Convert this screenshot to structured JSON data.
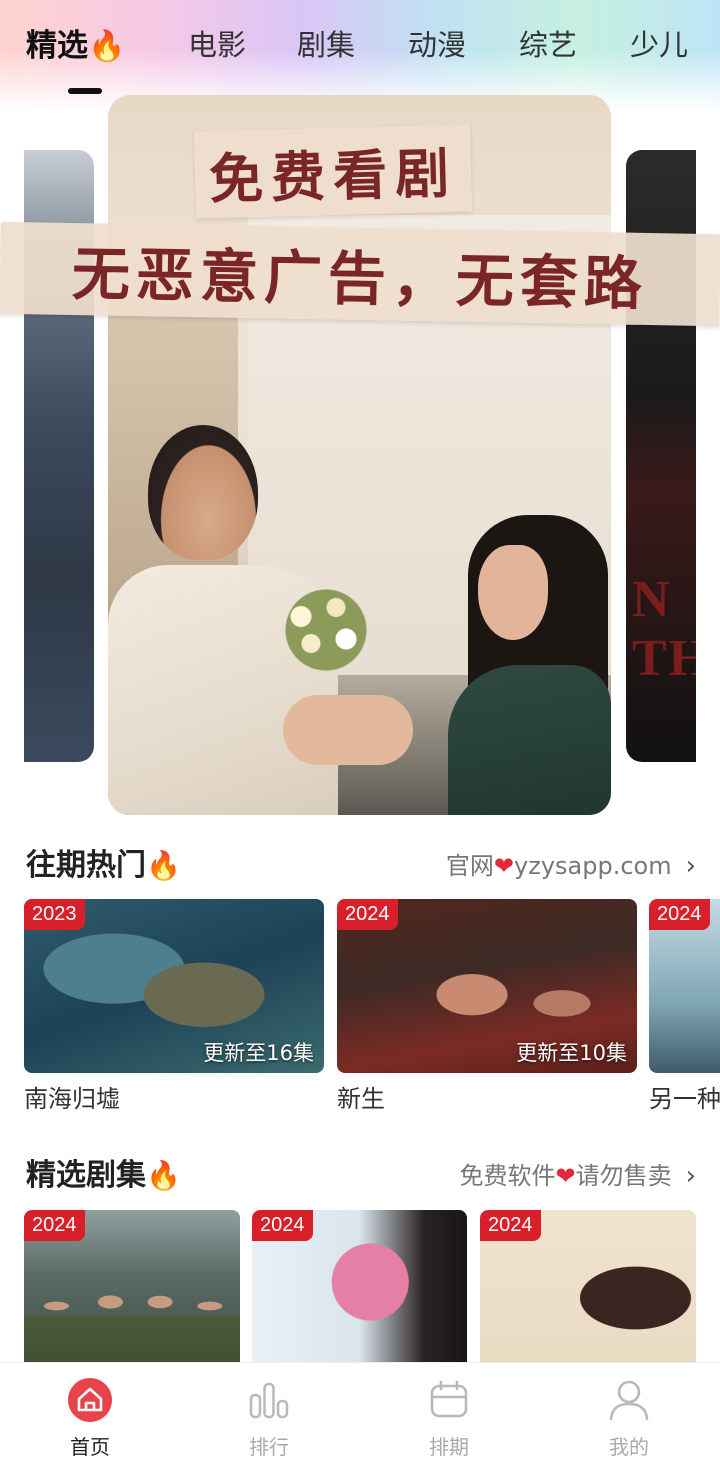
{
  "tabs": [
    {
      "label": "精选",
      "icon": "flame-icon"
    },
    {
      "label": "电影"
    },
    {
      "label": "剧集"
    },
    {
      "label": "动漫"
    },
    {
      "label": "综艺"
    },
    {
      "label": "少儿"
    }
  ],
  "banner": {
    "line1": "免费看剧",
    "line2": "无恶意广告，无套路"
  },
  "section_hot": {
    "title": "往期热门",
    "link_prefix": "官网",
    "link_suffix": "yzysapp.com",
    "cards": [
      {
        "year": "2023",
        "update": "更新至16集",
        "title": "南海归墟"
      },
      {
        "year": "2024",
        "update": "更新至10集",
        "title": "新生"
      },
      {
        "year": "2024",
        "update": "",
        "title": "另一种"
      }
    ]
  },
  "section_featured": {
    "title": "精选剧集",
    "link_prefix": "免费软件",
    "link_suffix": "请勿售卖",
    "cards": [
      {
        "year": "2024"
      },
      {
        "year": "2024"
      },
      {
        "year": "2024"
      }
    ]
  },
  "bottom_nav": [
    {
      "label": "首页",
      "icon": "home-icon",
      "active": true
    },
    {
      "label": "排行",
      "icon": "ranking-icon"
    },
    {
      "label": "排期",
      "icon": "calendar-icon"
    },
    {
      "label": "我的",
      "icon": "profile-icon"
    }
  ],
  "colors": {
    "accent": "#e8434a",
    "badge": "#d8202a",
    "heart": "#e02a3a"
  }
}
